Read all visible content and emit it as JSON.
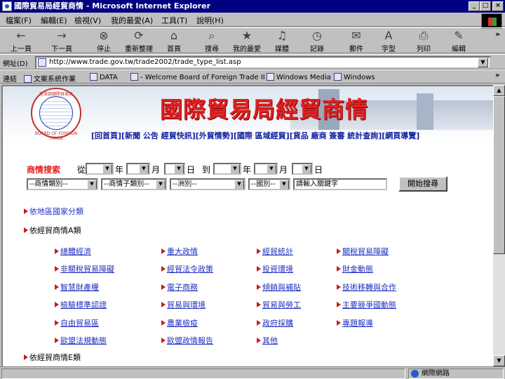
{
  "window": {
    "title": "國際貿易局經貿商情 - Microsoft Internet Explorer",
    "controls": [
      "_",
      "□",
      "×"
    ]
  },
  "menu": [
    "檔案(F)",
    "編輯(E)",
    "檢視(V)",
    "我的最愛(A)",
    "工具(T)",
    "說明(H)"
  ],
  "toolbar": [
    {
      "label": "上一頁",
      "icon": "back-arrow-icon",
      "glyph": "←"
    },
    {
      "label": "下一頁",
      "icon": "forward-arrow-icon",
      "glyph": "→"
    },
    {
      "label": "停止",
      "icon": "stop-icon",
      "glyph": "⊗"
    },
    {
      "label": "重新整理",
      "icon": "refresh-icon",
      "glyph": "⟳"
    },
    {
      "label": "首頁",
      "icon": "home-icon",
      "glyph": "⌂"
    },
    {
      "label": "搜尋",
      "icon": "search-icon",
      "glyph": "⌕"
    },
    {
      "label": "我的最愛",
      "icon": "favorites-icon",
      "glyph": "★"
    },
    {
      "label": "媒體",
      "icon": "media-icon",
      "glyph": "♫"
    },
    {
      "label": "記錄",
      "icon": "history-icon",
      "glyph": "◷"
    },
    {
      "label": "郵件",
      "icon": "mail-icon",
      "glyph": "✉"
    },
    {
      "label": "字型",
      "icon": "font-icon",
      "glyph": "A"
    },
    {
      "label": "列印",
      "icon": "print-icon",
      "glyph": "⎙"
    },
    {
      "label": "編輯",
      "icon": "edit-icon",
      "glyph": "✎"
    }
  ],
  "address": {
    "label": "網址(D)",
    "url": "http://www.trade.gov.tw/trade2002/trade_type_list.asp"
  },
  "links": {
    "label": "連結",
    "items": [
      "文案系統作業",
      "DATA",
      "- Welcome Board of Foreign Trade II --",
      "Windows Media",
      "Windows"
    ]
  },
  "banner": {
    "title": "國際貿易局經貿商情",
    "seal_top": "經濟部國際貿易局",
    "seal_bottom": "BOARD OF FOREIGN TRADE",
    "nav": "[回首頁][新聞 公告 經貿快訊][外貿情勢][國際 區域經貿][貨品 廠商 簽審 統計查詢][網頁導覽]"
  },
  "search": {
    "heading": "商情搜索",
    "from": "從",
    "year": "年",
    "month": "月",
    "day": "日",
    "to": "到",
    "type_select": "--商情類別--",
    "sub_select": "--商情子類別--",
    "continent_select": "--洲別--",
    "country_select": "--國別--",
    "keyword_placeholder": "請輸入關鍵字",
    "button": "開始搜尋"
  },
  "categories": {
    "by_region": "依地區國家分類",
    "by_type_a": "依經貿商情A類",
    "by_type_e": "依經貿商情E類"
  },
  "topics": [
    [
      "總體經濟",
      "重大政情",
      "經貿統計",
      "關稅貿易障礙"
    ],
    [
      "非關稅貿易障礙",
      "經貿法令政策",
      "投資環境",
      "財金動態"
    ],
    [
      "智慧財產權",
      "電子商務",
      "傾銷與補貼",
      "技術移轉與合作"
    ],
    [
      "檢驗標準認證",
      "貿易與環境",
      "貿易與勞工",
      "主要競爭國動態"
    ],
    [
      "自由貿易區",
      "農業檢疫",
      "政府採購",
      "專題報導"
    ],
    [
      "歐盟法規動態",
      "歐盟政情報告",
      "其他",
      ""
    ]
  ],
  "status": {
    "zone": "網際網路"
  }
}
